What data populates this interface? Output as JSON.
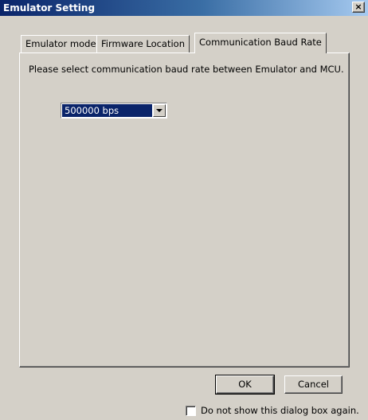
{
  "window": {
    "title": "Emulator Setting",
    "close_glyph": "×"
  },
  "tabs": [
    {
      "label": "Emulator mode",
      "active": false
    },
    {
      "label": "Firmware Location",
      "active": false
    },
    {
      "label": "Communication Baud Rate",
      "active": true
    }
  ],
  "panel": {
    "prompt": "Please select communication baud rate between Emulator and MCU.",
    "baud_select": {
      "value": "500000 bps"
    }
  },
  "footer": {
    "ok_label": "OK",
    "cancel_label": "Cancel",
    "checkbox_label": "Do not show this dialog box again.",
    "checkbox_checked": false
  },
  "colors": {
    "face": "#d4d0c8",
    "title_start": "#0a246a",
    "title_end": "#a6caf0",
    "selection": "#0a246a"
  }
}
